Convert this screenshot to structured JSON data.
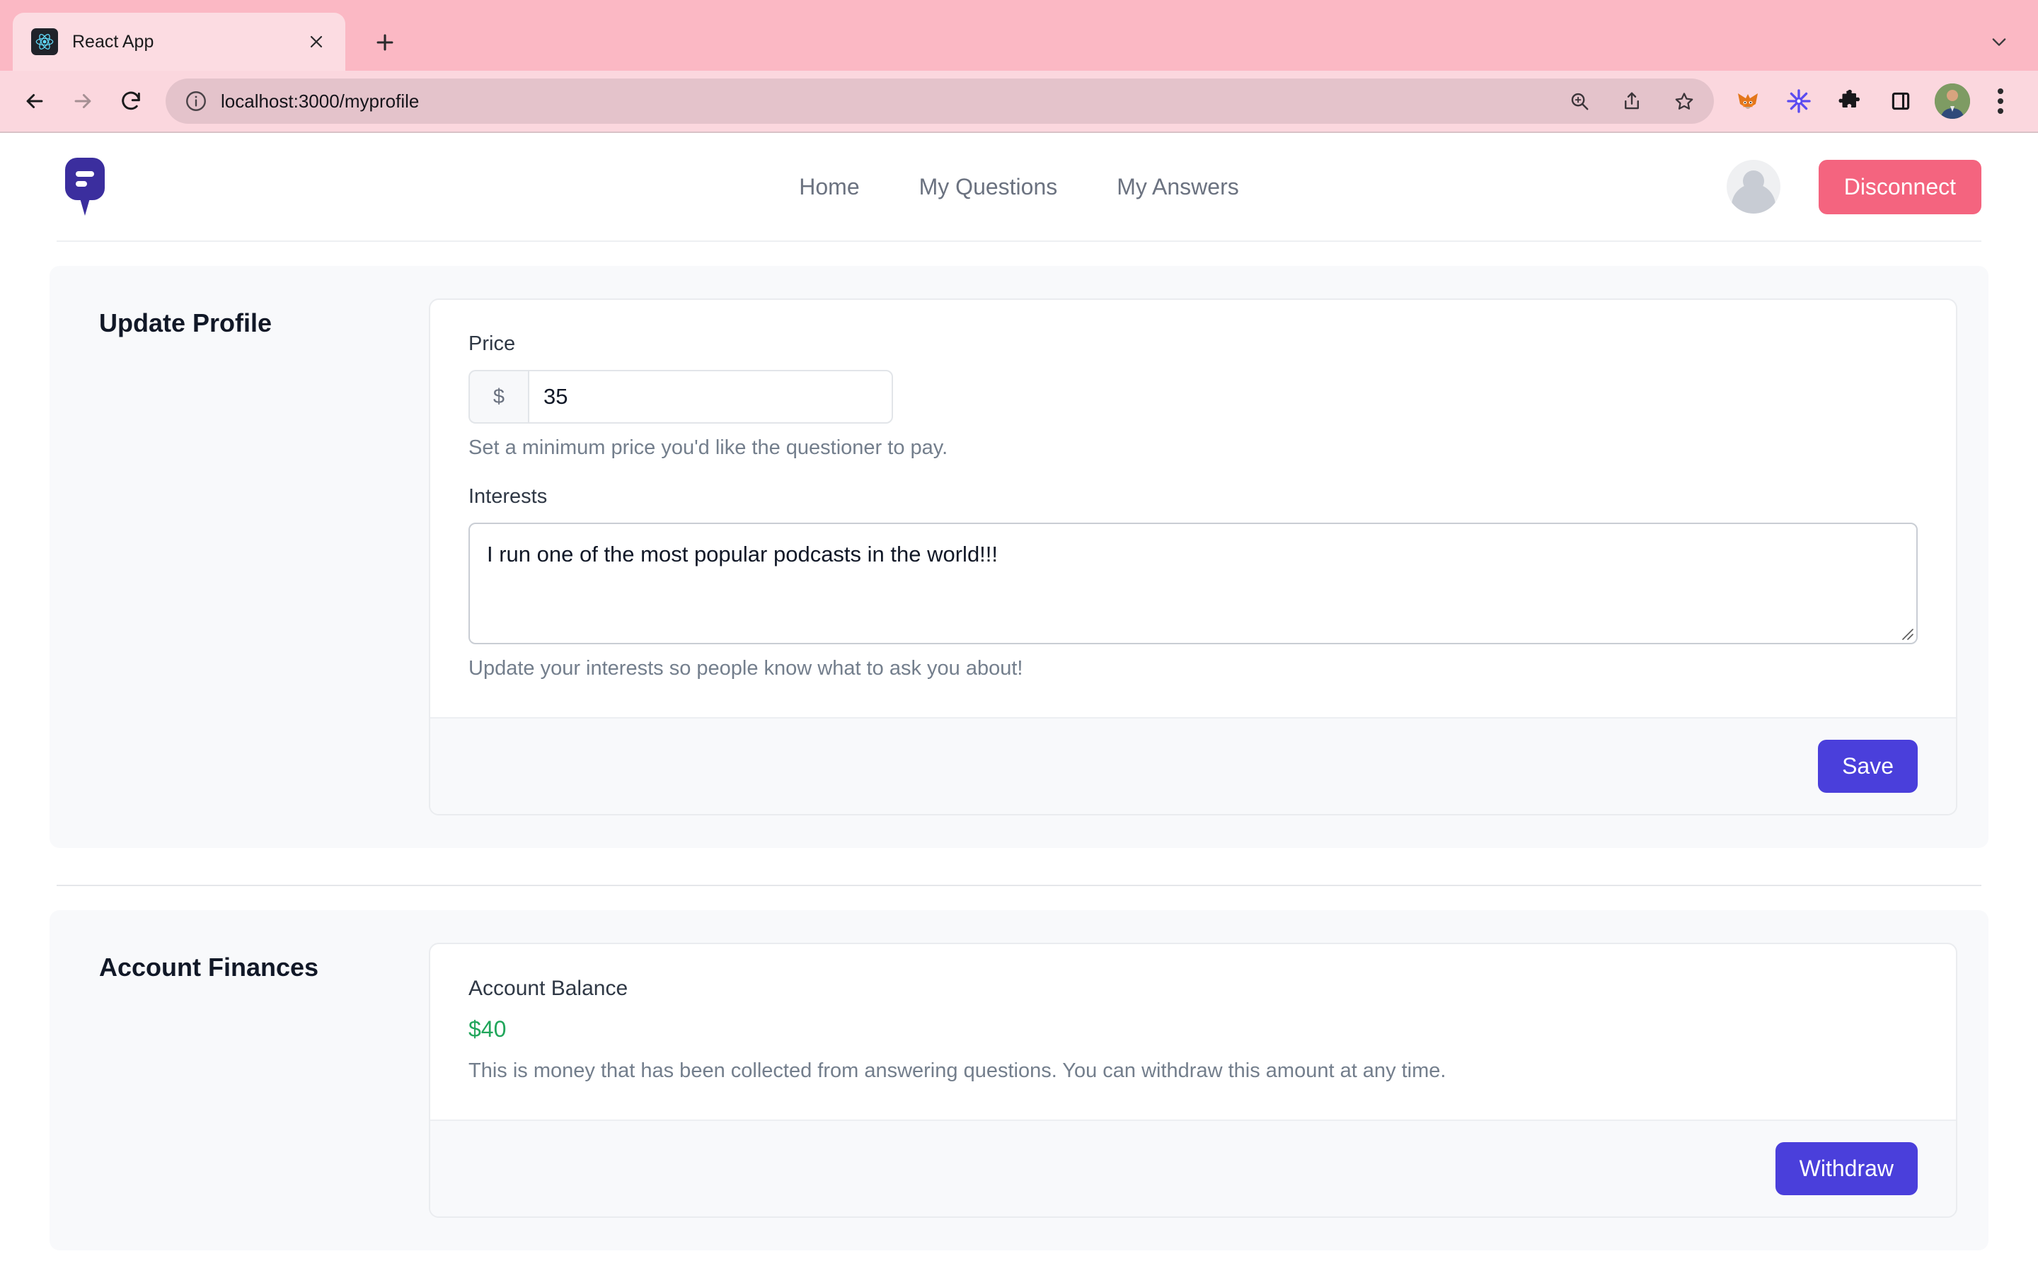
{
  "browser": {
    "tab": {
      "title": "React App",
      "favicon_icon": "react-logo-icon",
      "close_icon": "close-icon"
    },
    "new_tab_icon": "plus-icon",
    "tab_list_icon": "chevron-down-icon",
    "nav": {
      "back_icon": "back-arrow-icon",
      "forward_icon": "forward-arrow-icon",
      "reload_icon": "reload-icon"
    },
    "omnibox": {
      "info_icon": "info-circle-icon",
      "url_host": "localhost:3000",
      "url_path": "/myprofile",
      "url_full": "localhost:3000/myprofile",
      "zoom_icon": "zoom-in-icon",
      "share_icon": "share-icon",
      "bookmark_icon": "star-icon"
    },
    "extensions": [
      {
        "name": "metamask-extension-icon"
      },
      {
        "name": "asterisk-extension-icon"
      },
      {
        "name": "puzzle-extensions-icon"
      },
      {
        "name": "side-panel-icon"
      }
    ],
    "profile_avatar_icon": "profile-photo-avatar",
    "menu_icon": "three-dot-menu-icon"
  },
  "app": {
    "brand": {
      "icon": "chat-bubble-logo-icon"
    },
    "nav_links": [
      {
        "label": "Home"
      },
      {
        "label": "My Questions"
      },
      {
        "label": "My Answers"
      }
    ],
    "user_avatar_icon": "user-placeholder-avatar",
    "disconnect_label": "Disconnect"
  },
  "update_profile": {
    "section_title": "Update Profile",
    "price": {
      "label": "Price",
      "currency_symbol": "$",
      "value": "35",
      "placeholder": "",
      "help": "Set a minimum price you'd like the questioner to pay."
    },
    "interests": {
      "label": "Interests",
      "value": "I run one of the most popular podcasts in the world!!!",
      "placeholder": "",
      "help": "Update your interests so people know what to ask you about!"
    },
    "save_label": "Save"
  },
  "account_finances": {
    "section_title": "Account Finances",
    "balance_label": "Account Balance",
    "balance_amount": "$40",
    "balance_desc": "This is money that has been collected from answering questions. You can withdraw this amount at any time.",
    "withdraw_label": "Withdraw"
  },
  "colors": {
    "browser_chrome": "#FBB8C4",
    "brand_purple": "#3B2E9E",
    "primary_button": "#4A3FDB",
    "disconnect_button": "#F4647F",
    "balance_green": "#21A65B",
    "section_bg": "#F8F9FB"
  }
}
